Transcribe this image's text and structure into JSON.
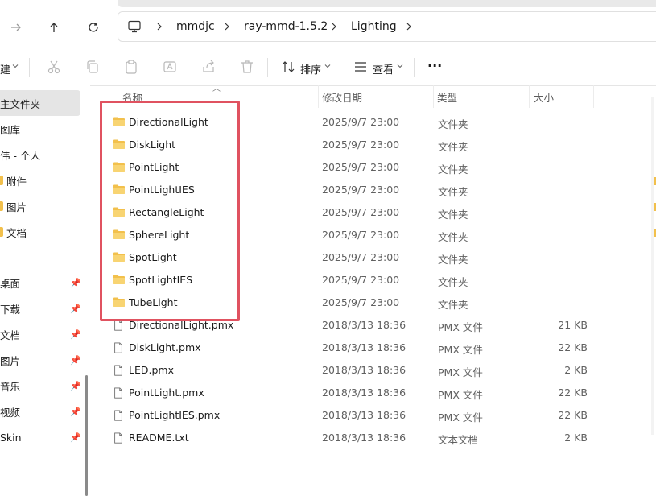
{
  "breadcrumb": [
    "mmdjc",
    "ray-mmd-1.5.2",
    "Lighting"
  ],
  "toolbar": {
    "new_label": "建",
    "sort_label": "排序",
    "view_label": "查看",
    "more_label": "···"
  },
  "sidebar": {
    "items": [
      {
        "label": "主文件夹",
        "selected": true
      },
      {
        "label": "图库"
      },
      {
        "label": "伟 - 个人"
      },
      {
        "label": "附件",
        "folder": true
      },
      {
        "label": "图片",
        "folder": true
      },
      {
        "label": "文档",
        "folder": true
      }
    ],
    "pinned": [
      {
        "label": "桌面"
      },
      {
        "label": "下载"
      },
      {
        "label": "文档"
      },
      {
        "label": "图片"
      },
      {
        "label": "音乐"
      },
      {
        "label": "视频"
      },
      {
        "label": "Skin"
      }
    ]
  },
  "columns": {
    "name": "名称",
    "date": "修改日期",
    "type": "类型",
    "size": "大小"
  },
  "files": [
    {
      "name": "DirectionalLight",
      "date": "2025/9/7 23:00",
      "type": "文件夹",
      "size": "",
      "kind": "folder"
    },
    {
      "name": "DiskLight",
      "date": "2025/9/7 23:00",
      "type": "文件夹",
      "size": "",
      "kind": "folder"
    },
    {
      "name": "PointLight",
      "date": "2025/9/7 23:00",
      "type": "文件夹",
      "size": "",
      "kind": "folder"
    },
    {
      "name": "PointLightIES",
      "date": "2025/9/7 23:00",
      "type": "文件夹",
      "size": "",
      "kind": "folder"
    },
    {
      "name": "RectangleLight",
      "date": "2025/9/7 23:00",
      "type": "文件夹",
      "size": "",
      "kind": "folder"
    },
    {
      "name": "SphereLight",
      "date": "2025/9/7 23:00",
      "type": "文件夹",
      "size": "",
      "kind": "folder"
    },
    {
      "name": "SpotLight",
      "date": "2025/9/7 23:00",
      "type": "文件夹",
      "size": "",
      "kind": "folder"
    },
    {
      "name": "SpotLightIES",
      "date": "2025/9/7 23:00",
      "type": "文件夹",
      "size": "",
      "kind": "folder"
    },
    {
      "name": "TubeLight",
      "date": "2025/9/7 23:00",
      "type": "文件夹",
      "size": "",
      "kind": "folder"
    },
    {
      "name": "DirectionalLight.pmx",
      "date": "2018/3/13 18:36",
      "type": "PMX 文件",
      "size": "21 KB",
      "kind": "file"
    },
    {
      "name": "DiskLight.pmx",
      "date": "2018/3/13 18:36",
      "type": "PMX 文件",
      "size": "22 KB",
      "kind": "file"
    },
    {
      "name": "LED.pmx",
      "date": "2018/3/13 18:36",
      "type": "PMX 文件",
      "size": "2 KB",
      "kind": "file"
    },
    {
      "name": "PointLight.pmx",
      "date": "2018/3/13 18:36",
      "type": "PMX 文件",
      "size": "22 KB",
      "kind": "file"
    },
    {
      "name": "PointLightIES.pmx",
      "date": "2018/3/13 18:36",
      "type": "PMX 文件",
      "size": "22 KB",
      "kind": "file"
    },
    {
      "name": "README.txt",
      "date": "2018/3/13 18:36",
      "type": "文本文档",
      "size": "2 KB",
      "kind": "file"
    }
  ],
  "colors": {
    "folder": "#f2c04c",
    "highlight": "#e05260",
    "selected": "#e5e5e5"
  }
}
